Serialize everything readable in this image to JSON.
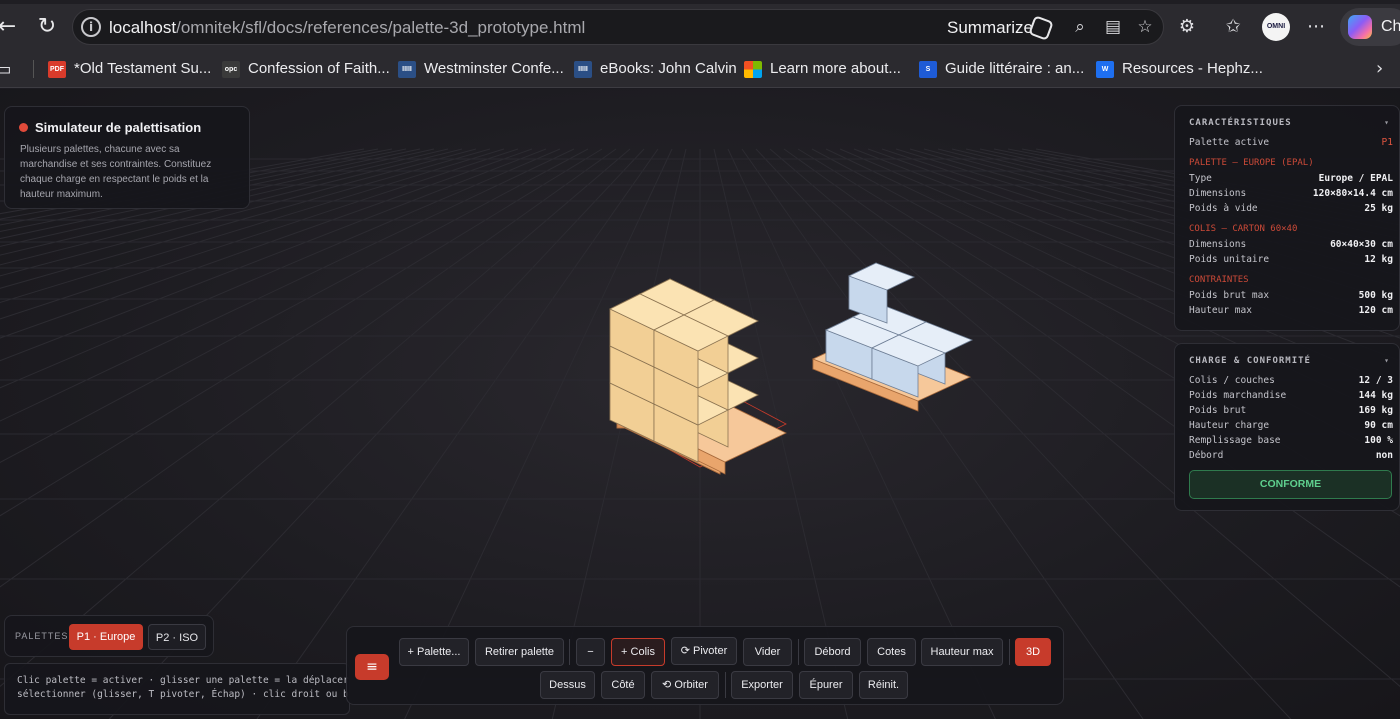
{
  "browser": {
    "url_host": "localhost",
    "url_path": "/omnitek/sfl/docs/references/palette-3d_prototype.html",
    "summarize_label": "Summarize",
    "profile_label": "OMNI",
    "copilot_label": "Cha"
  },
  "bookmarks": [
    {
      "label": "*Old Testament Su...",
      "icon": "pdf-icon",
      "icon_text": "PDF",
      "color": "#d93b2b"
    },
    {
      "label": "Confession of Faith...",
      "icon": "opc-icon",
      "icon_text": "opc",
      "color": "#3a3a3a"
    },
    {
      "label": "Westminster Confe...",
      "icon": "wts-icon",
      "icon_text": "IIIII",
      "color": "#2b4f86"
    },
    {
      "label": "eBooks: John Calvin",
      "icon": "wts-icon",
      "icon_text": "IIIII",
      "color": "#2b4f86"
    },
    {
      "label": "Learn more about...",
      "icon": "microsoft-icon",
      "icon_text": "",
      "color": "#f25022"
    },
    {
      "label": "Guide littéraire : an...",
      "icon": "s-icon",
      "icon_text": "S",
      "color": "#1e5bd6"
    },
    {
      "label": "Resources - Hephz...",
      "icon": "w-icon",
      "icon_text": "W",
      "color": "#1e6ff0"
    }
  ],
  "simulator": {
    "title": "Simulateur de palettisation",
    "description": "Plusieurs palettes, chacune avec sa marchandise et ses contraintes. Constituez chaque charge en respectant le poids et la hauteur maximum."
  },
  "specs": {
    "heading": "CARACTÉRISTIQUES",
    "active_label": "Palette active",
    "active_value": "P1",
    "palette_heading": "PALETTE — EUROPE (EPAL)",
    "palette_rows": [
      {
        "k": "Type",
        "v": "Europe / EPAL"
      },
      {
        "k": "Dimensions",
        "v": "120×80×14.4 cm"
      },
      {
        "k": "Poids à vide",
        "v": "25 kg"
      }
    ],
    "colis_heading": "COLIS — CARTON 60×40",
    "colis_rows": [
      {
        "k": "Dimensions",
        "v": "60×40×30 cm"
      },
      {
        "k": "Poids unitaire",
        "v": "12 kg"
      }
    ],
    "constraints_heading": "CONTRAINTES",
    "constraint_rows": [
      {
        "k": "Poids brut max",
        "v": "500 kg"
      },
      {
        "k": "Hauteur max",
        "v": "120 cm"
      }
    ]
  },
  "charge": {
    "heading": "CHARGE & CONFORMITÉ",
    "rows": [
      {
        "k": "Colis / couches",
        "v": "12 / 3"
      },
      {
        "k": "Poids marchandise",
        "v": "144 kg"
      },
      {
        "k": "Poids brut",
        "v": "169 kg"
      },
      {
        "k": "Hauteur charge",
        "v": "90 cm"
      },
      {
        "k": "Remplissage base",
        "v": "100 %"
      },
      {
        "k": "Débord",
        "v": "non"
      }
    ],
    "status": "CONFORME"
  },
  "palettes": {
    "label": "PALETTES",
    "items": [
      {
        "label": "P1 · Europe",
        "active": true
      },
      {
        "label": "P2 · ISO",
        "active": false
      }
    ]
  },
  "help": {
    "line1": "Clic palette = activer · glisser une palette = la déplacer ·",
    "line2": "sélectionner (glisser, T pivoter, Échap) · clic droit ou bou"
  },
  "toolbar": {
    "menu_icon": "≡",
    "row1": [
      {
        "label": "+ Palette..."
      },
      {
        "label": "Retirer palette"
      },
      {
        "label": "−"
      },
      {
        "label": "+ Colis"
      },
      {
        "label": "⟳ Pivoter"
      },
      {
        "label": "Vider"
      },
      {
        "label": "Débord"
      },
      {
        "label": "Cotes"
      },
      {
        "label": "Hauteur max"
      },
      {
        "label": "3D"
      }
    ],
    "row2": [
      {
        "label": "Dessus"
      },
      {
        "label": "Côté"
      },
      {
        "label": "⟲ Orbiter"
      },
      {
        "label": "Exporter"
      },
      {
        "label": "Épurer"
      },
      {
        "label": "Réinit."
      }
    ]
  },
  "colors": {
    "accent": "#c73b2b",
    "ok": "#5fd08e",
    "carton": "#f3d49e",
    "iso_box": "#c9dcf0",
    "pallet_wood": "#f0b27a"
  }
}
